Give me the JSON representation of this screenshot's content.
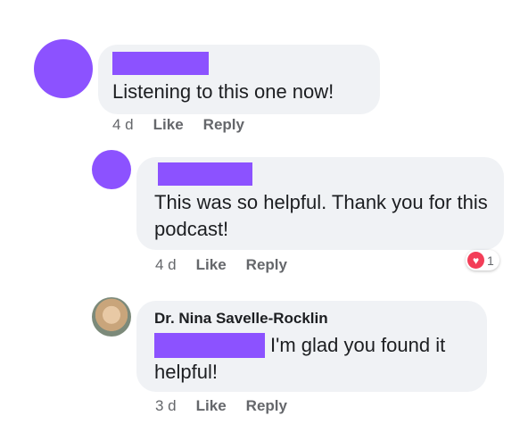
{
  "comments": [
    {
      "text": "Listening to this one now!",
      "meta": {
        "time": "4 d",
        "like": "Like",
        "reply": "Reply"
      }
    },
    {
      "text": "This was so helpful. Thank you for this podcast!",
      "meta": {
        "time": "4 d",
        "like": "Like",
        "reply": "Reply"
      },
      "reaction": {
        "icon": "heart-icon",
        "count": "1"
      }
    },
    {
      "author": "Dr. Nina Savelle-Rocklin",
      "text_after_mention": "I'm glad you found it",
      "text_line2": "helpful!",
      "meta": {
        "time": "3 d",
        "like": "Like",
        "reply": "Reply"
      }
    }
  ],
  "colors": {
    "redaction": "#8c52ff",
    "bubble": "#f0f2f5",
    "meta_text": "#65676b",
    "heart": "#f33e58"
  }
}
